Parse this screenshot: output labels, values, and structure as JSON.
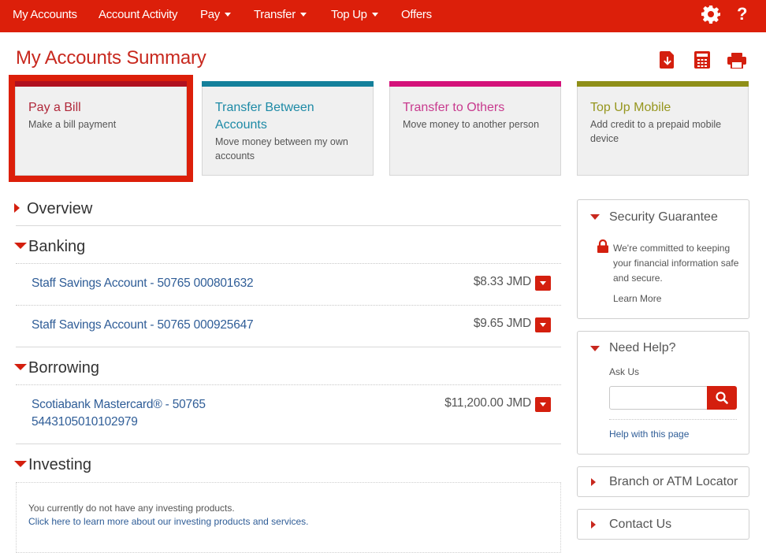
{
  "topnav": {
    "items": [
      {
        "label": "My Accounts",
        "has_dropdown": false
      },
      {
        "label": "Account Activity",
        "has_dropdown": false
      },
      {
        "label": "Pay",
        "has_dropdown": true
      },
      {
        "label": "Transfer",
        "has_dropdown": true
      },
      {
        "label": "Top Up",
        "has_dropdown": true
      },
      {
        "label": "Offers",
        "has_dropdown": false
      }
    ],
    "icons": [
      "gear-icon",
      "help-icon"
    ],
    "help_glyph": "?"
  },
  "page": {
    "title": "My Accounts Summary",
    "tools": [
      "download-pdf-icon",
      "calculator-icon",
      "print-icon"
    ]
  },
  "colors": {
    "brand_red": "#dc1f0a",
    "pay_bill": "#b01020",
    "transfer_between": "#14809b",
    "transfer_others": "#d4127a",
    "top_up": "#8f8f18",
    "link_blue": "#2f5d97"
  },
  "quick_actions": [
    {
      "title": "Pay a Bill",
      "desc": "Make a bill payment",
      "selected": true
    },
    {
      "title": "Transfer Between Accounts",
      "desc": "Move money between my own accounts",
      "selected": false
    },
    {
      "title": "Transfer to Others",
      "desc": "Move money to another person",
      "selected": false
    },
    {
      "title": "Top Up Mobile",
      "desc": "Add credit to a prepaid mobile device",
      "selected": false
    }
  ],
  "sections": {
    "overview": {
      "label": "Overview",
      "expanded": false
    },
    "banking": {
      "label": "Banking",
      "expanded": true,
      "accounts": [
        {
          "name": "Staff Savings Account - 50765 000801632",
          "balance": "$8.33 JMD"
        },
        {
          "name": "Staff Savings Account - 50765 000925647",
          "balance": "$9.65 JMD"
        }
      ]
    },
    "borrowing": {
      "label": "Borrowing",
      "expanded": true,
      "accounts": [
        {
          "name_line1": "Scotiabank Mastercard® - 50765",
          "name_line2": "5443105010102979",
          "balance": "$11,200.00 JMD"
        }
      ]
    },
    "investing": {
      "label": "Investing",
      "expanded": true,
      "empty_text": "You currently do not have any investing products.",
      "learn_link": "Click here to learn more about our investing products and services."
    }
  },
  "sidebar": {
    "security": {
      "title": "Security Guarantee",
      "text_lines": [
        "We're committed to keeping",
        "your financial information safe",
        "and secure."
      ],
      "link": "Learn More"
    },
    "help": {
      "title": "Need Help?",
      "ask_label": "Ask Us",
      "input_value": "",
      "input_placeholder": "",
      "link": "Help with this page"
    },
    "locator": {
      "title": "Branch or ATM Locator"
    },
    "contact": {
      "title": "Contact Us"
    }
  }
}
